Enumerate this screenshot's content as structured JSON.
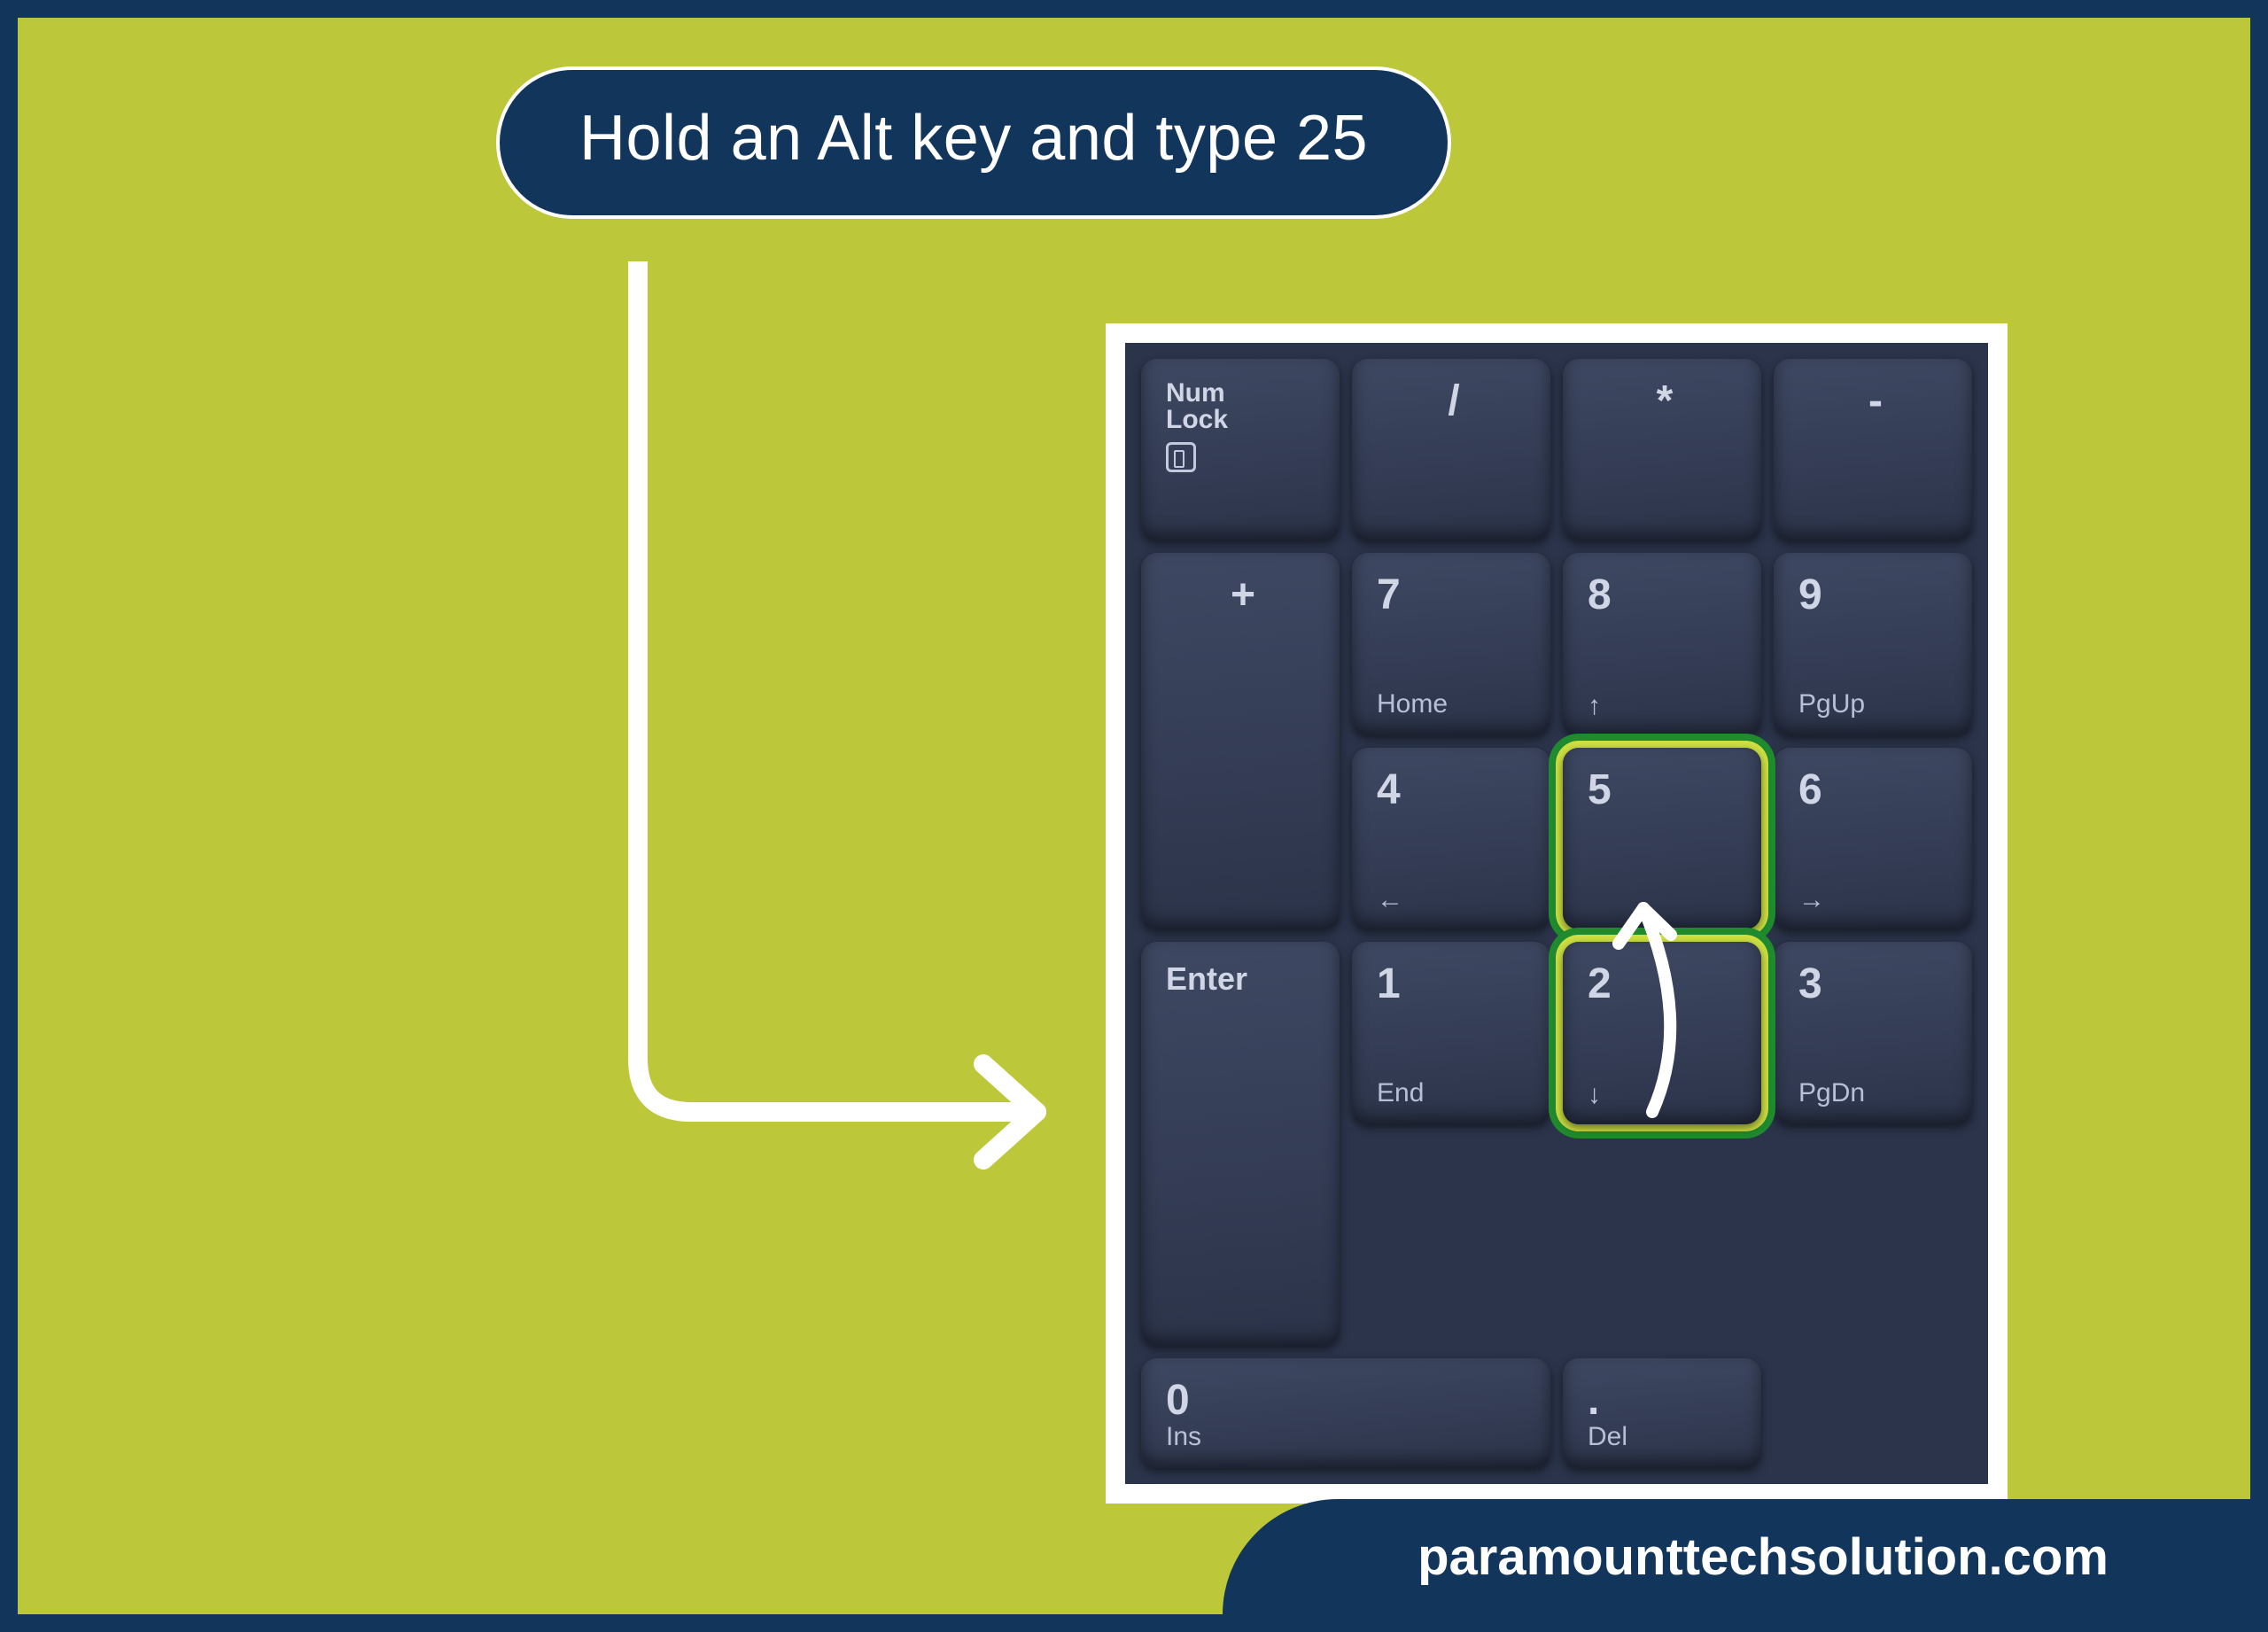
{
  "callout_text": "Hold an Alt key and type 25",
  "footer_text": "paramounttechsolution.com",
  "keypad": {
    "row1": {
      "numlock": "Num\nLock",
      "slash": "/",
      "star": "*",
      "minus": "-"
    },
    "row2": {
      "seven_p": "7",
      "seven_s": "Home",
      "eight_p": "8",
      "eight_s": "↑",
      "nine_p": "9",
      "nine_s": "PgUp",
      "plus": "+"
    },
    "row3": {
      "four_p": "4",
      "four_s": "←",
      "five_p": "5",
      "six_p": "6",
      "six_s": "→"
    },
    "row4": {
      "one_p": "1",
      "one_s": "End",
      "two_p": "2",
      "two_s": "↓",
      "three_p": "3",
      "three_s": "PgDn",
      "enter": "Enter"
    },
    "row5": {
      "zero_p": "0",
      "zero_s": "Ins",
      "dot_p": ".",
      "dot_s": "Del"
    }
  },
  "highlights": [
    "key-5",
    "key-2"
  ]
}
